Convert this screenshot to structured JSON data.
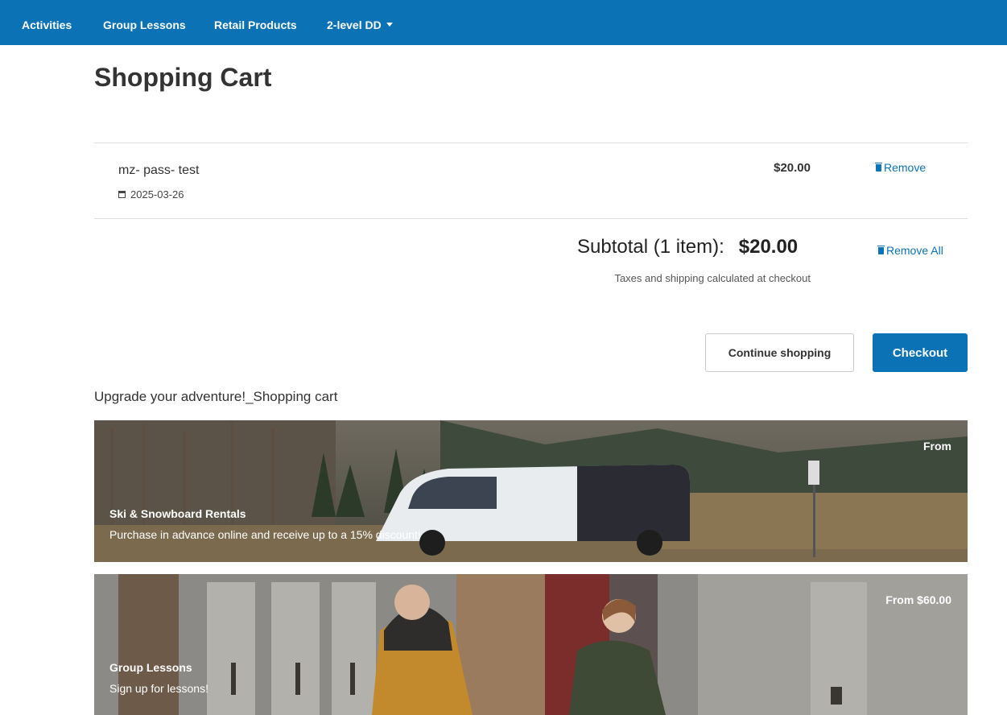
{
  "nav": {
    "items": [
      {
        "label": "Activities"
      },
      {
        "label": "Group Lessons"
      },
      {
        "label": "Retail Products"
      },
      {
        "label": "2-level DD"
      }
    ]
  },
  "page": {
    "title": "Shopping Cart"
  },
  "cart": {
    "items": [
      {
        "name": "mz- pass- test",
        "date": "2025-03-26",
        "price": "$20.00",
        "remove_label": "Remove"
      }
    ],
    "subtotal_label": "Subtotal (1 item):",
    "subtotal_amount": "$20.00",
    "remove_all_label": "Remove All",
    "tax_note": "Taxes and shipping calculated at checkout",
    "continue_label": "Continue shopping",
    "checkout_label": "Checkout"
  },
  "upsell": {
    "heading": "Upgrade your adventure!_Shopping cart",
    "cards": [
      {
        "title": "Ski & Snowboard Rentals",
        "description": "Purchase in advance online and receive up to a 15% discount!",
        "price": "From"
      },
      {
        "title": "Group Lessons",
        "description": "Sign up for lessons!",
        "price": "From $60.00"
      }
    ]
  },
  "colors": {
    "brand": "#0b72b5",
    "divider": "#dedede"
  }
}
